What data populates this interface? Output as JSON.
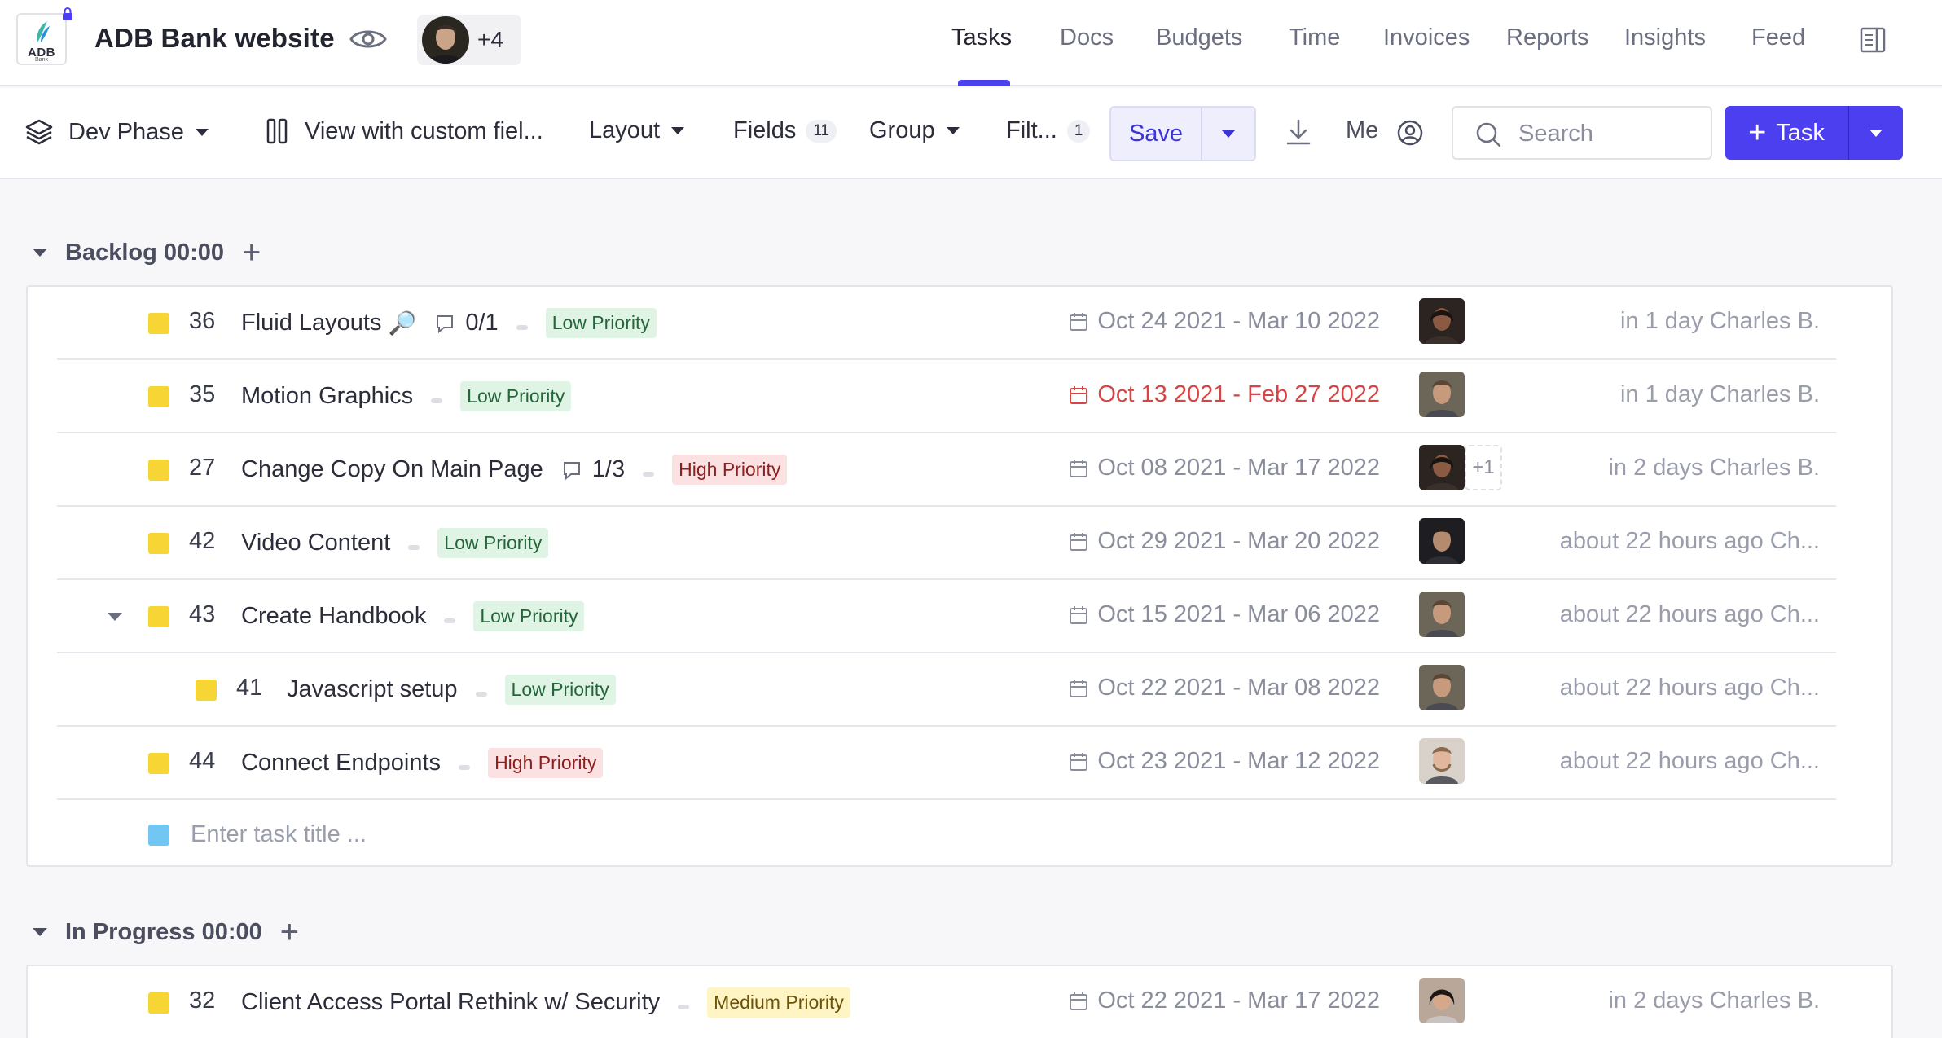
{
  "header": {
    "logo_text": "ADB",
    "logo_sub": "Bank",
    "project_title": "ADB Bank website",
    "members_more": "+4",
    "tabs": [
      {
        "label": "Tasks",
        "active": true
      },
      {
        "label": "Docs",
        "active": false
      },
      {
        "label": "Budgets",
        "active": false
      },
      {
        "label": "Time",
        "active": false
      },
      {
        "label": "Invoices",
        "active": false
      },
      {
        "label": "Reports",
        "active": false
      },
      {
        "label": "Insights",
        "active": false
      },
      {
        "label": "Feed",
        "active": false
      }
    ]
  },
  "toolbar": {
    "phase": "Dev Phase",
    "view": "View with custom fiel...",
    "layout": "Layout",
    "fields": "Fields",
    "fields_count": "11",
    "group": "Group",
    "filter": "Filt...",
    "filter_count": "1",
    "save": "Save",
    "me": "Me",
    "search_placeholder": "Search",
    "task_button": "Task"
  },
  "colors": {
    "accent": "#4b3ff0",
    "status_yellow": "#f6d534",
    "status_blue": "#72c6f3",
    "overdue": "#d64545"
  },
  "groups": [
    {
      "title": "Backlog 00:00",
      "rows": [
        {
          "id": "36",
          "title": "Fluid Layouts",
          "icon": "magnifier-icon",
          "subtasks": "0/1",
          "priority": "Low Priority",
          "priority_level": "low",
          "dates": "Oct 24 2021 - Mar 10 2022",
          "overdue": false,
          "updated": "in 1 day Charles B."
        },
        {
          "id": "35",
          "title": "Motion Graphics",
          "priority": "Low Priority",
          "priority_level": "low",
          "dates": "Oct 13 2021 - Feb 27 2022",
          "overdue": true,
          "updated": "in 1 day Charles B."
        },
        {
          "id": "27",
          "title": "Change Copy On Main Page",
          "subtasks": "1/3",
          "priority": "High Priority",
          "priority_level": "high",
          "dates": "Oct 08 2021 - Mar 17 2022",
          "overdue": false,
          "extra_assignees": "+1",
          "updated": "in 2 days Charles B."
        },
        {
          "id": "42",
          "title": "Video Content",
          "priority": "Low Priority",
          "priority_level": "low",
          "dates": "Oct 29 2021 - Mar 20 2022",
          "overdue": false,
          "updated": "about 22 hours ago Ch..."
        },
        {
          "id": "43",
          "title": "Create Handbook",
          "priority": "Low Priority",
          "priority_level": "low",
          "dates": "Oct 15 2021 - Mar 06 2022",
          "overdue": false,
          "expandable": true,
          "updated": "about 22 hours ago Ch..."
        },
        {
          "id": "41",
          "title": "Javascript setup",
          "priority": "Low Priority",
          "priority_level": "low",
          "dates": "Oct 22 2021 - Mar 08 2022",
          "overdue": false,
          "child": true,
          "updated": "about 22 hours ago Ch..."
        },
        {
          "id": "44",
          "title": "Connect Endpoints",
          "priority": "High Priority",
          "priority_level": "high",
          "dates": "Oct 23 2021 - Mar 12 2022",
          "overdue": false,
          "updated": "about 22 hours ago Ch..."
        }
      ],
      "new_task_placeholder": "Enter task title ..."
    },
    {
      "title": "In Progress 00:00",
      "rows": [
        {
          "id": "32",
          "title": "Client Access Portal Rethink w/ Security",
          "priority": "Medium Priority",
          "priority_level": "medium",
          "dates": "Oct 22 2021 - Mar 17 2022",
          "overdue": false,
          "updated": "in 2 days Charles B."
        }
      ]
    }
  ]
}
